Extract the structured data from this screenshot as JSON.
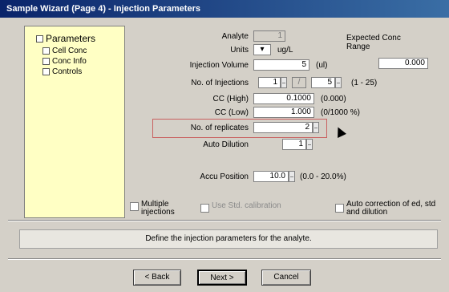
{
  "window": {
    "title": "Sample Wizard (Page 4) - Injection Parameters"
  },
  "tree": {
    "root": "Parameters",
    "items": [
      "Cell Conc",
      "Conc Info",
      "Controls"
    ]
  },
  "fields": {
    "analyte": {
      "label": "Analyte",
      "value": "1"
    },
    "units": {
      "label": "Units",
      "value": "ug/L"
    },
    "injection_volume": {
      "label": "Injection Volume",
      "value": "5",
      "unit": "(ul)"
    },
    "no_injections": {
      "label": "No. of Injections",
      "from": "1",
      "to": "5",
      "hint": "(1 - 25)"
    },
    "cc_high": {
      "label": "CC (High)",
      "value": "0.1000",
      "hint": "(0.000)"
    },
    "cc_low": {
      "label": "CC (Low)",
      "value": "1.000",
      "hint": "(0/1000 %)"
    },
    "no_replicates": {
      "label": "No. of replicates",
      "value": "2"
    },
    "auto_dilution": {
      "label": "Auto Dilution",
      "value": "1"
    },
    "accu_position": {
      "label": "Accu Position",
      "value": "10.0",
      "hint": "(0.0 - 20.0%)"
    }
  },
  "expected_conc": {
    "label": "Expected Conc Range",
    "value": "0.000"
  },
  "checkboxes": {
    "multiple": {
      "label": "Multiple injections",
      "checked": false
    },
    "use_std": {
      "label": "Use Std. calibration",
      "checked": false
    },
    "auto_correction": {
      "label": "Auto correction of ed, std and dilution",
      "checked": false
    }
  },
  "status": {
    "text": "Define the injection parameters for the analyte."
  },
  "buttons": {
    "back": "< Back",
    "next": "Next >",
    "cancel": "Cancel"
  },
  "colors": {
    "tree_bg": "#ffffc4",
    "highlight": "#c96060",
    "titlebar": "#0a246a"
  }
}
